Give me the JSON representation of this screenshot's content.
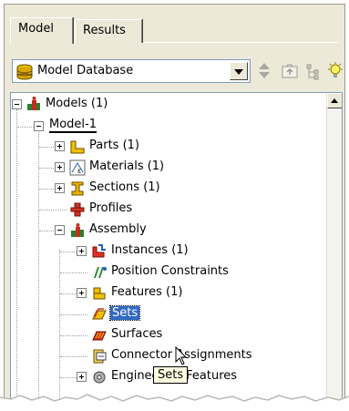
{
  "tabs": [
    {
      "label": "Model",
      "active": true
    },
    {
      "label": "Results",
      "active": false
    }
  ],
  "toolbar": {
    "combo_value": "Model Database",
    "icons": [
      "database-icon",
      "up-down-arrows-icon",
      "folder-up-icon",
      "tree-expand-icon",
      "lightbulb-icon"
    ]
  },
  "tree": {
    "root": {
      "label": "Models (1)",
      "icon": "models-icon"
    },
    "model": {
      "label": "Model-1"
    },
    "items": [
      {
        "label": "Parts (1)",
        "icon": "parts-icon"
      },
      {
        "label": "Materials (1)",
        "icon": "materials-icon"
      },
      {
        "label": "Sections (1)",
        "icon": "sections-icon"
      },
      {
        "label": "Profiles",
        "icon": "profiles-icon"
      },
      {
        "label": "Assembly",
        "icon": "assembly-icon"
      },
      {
        "label": "Instances (1)",
        "icon": "instances-icon"
      },
      {
        "label": "Position Constraints",
        "icon": "position-constraints-icon"
      },
      {
        "label": "Features (1)",
        "icon": "features-icon"
      },
      {
        "label": "Sets",
        "icon": "sets-icon"
      },
      {
        "label": "Surfaces",
        "icon": "surfaces-icon"
      },
      {
        "label": "Connector Assignments",
        "icon": "connector-assignments-icon"
      },
      {
        "label": "Engineering Features",
        "icon": "engineering-features-icon"
      }
    ]
  },
  "tooltip": "Sets",
  "colors": {
    "panel_bg": "#ece9d8",
    "selection": "#316ac5",
    "tooltip_bg": "#ffffe1"
  }
}
